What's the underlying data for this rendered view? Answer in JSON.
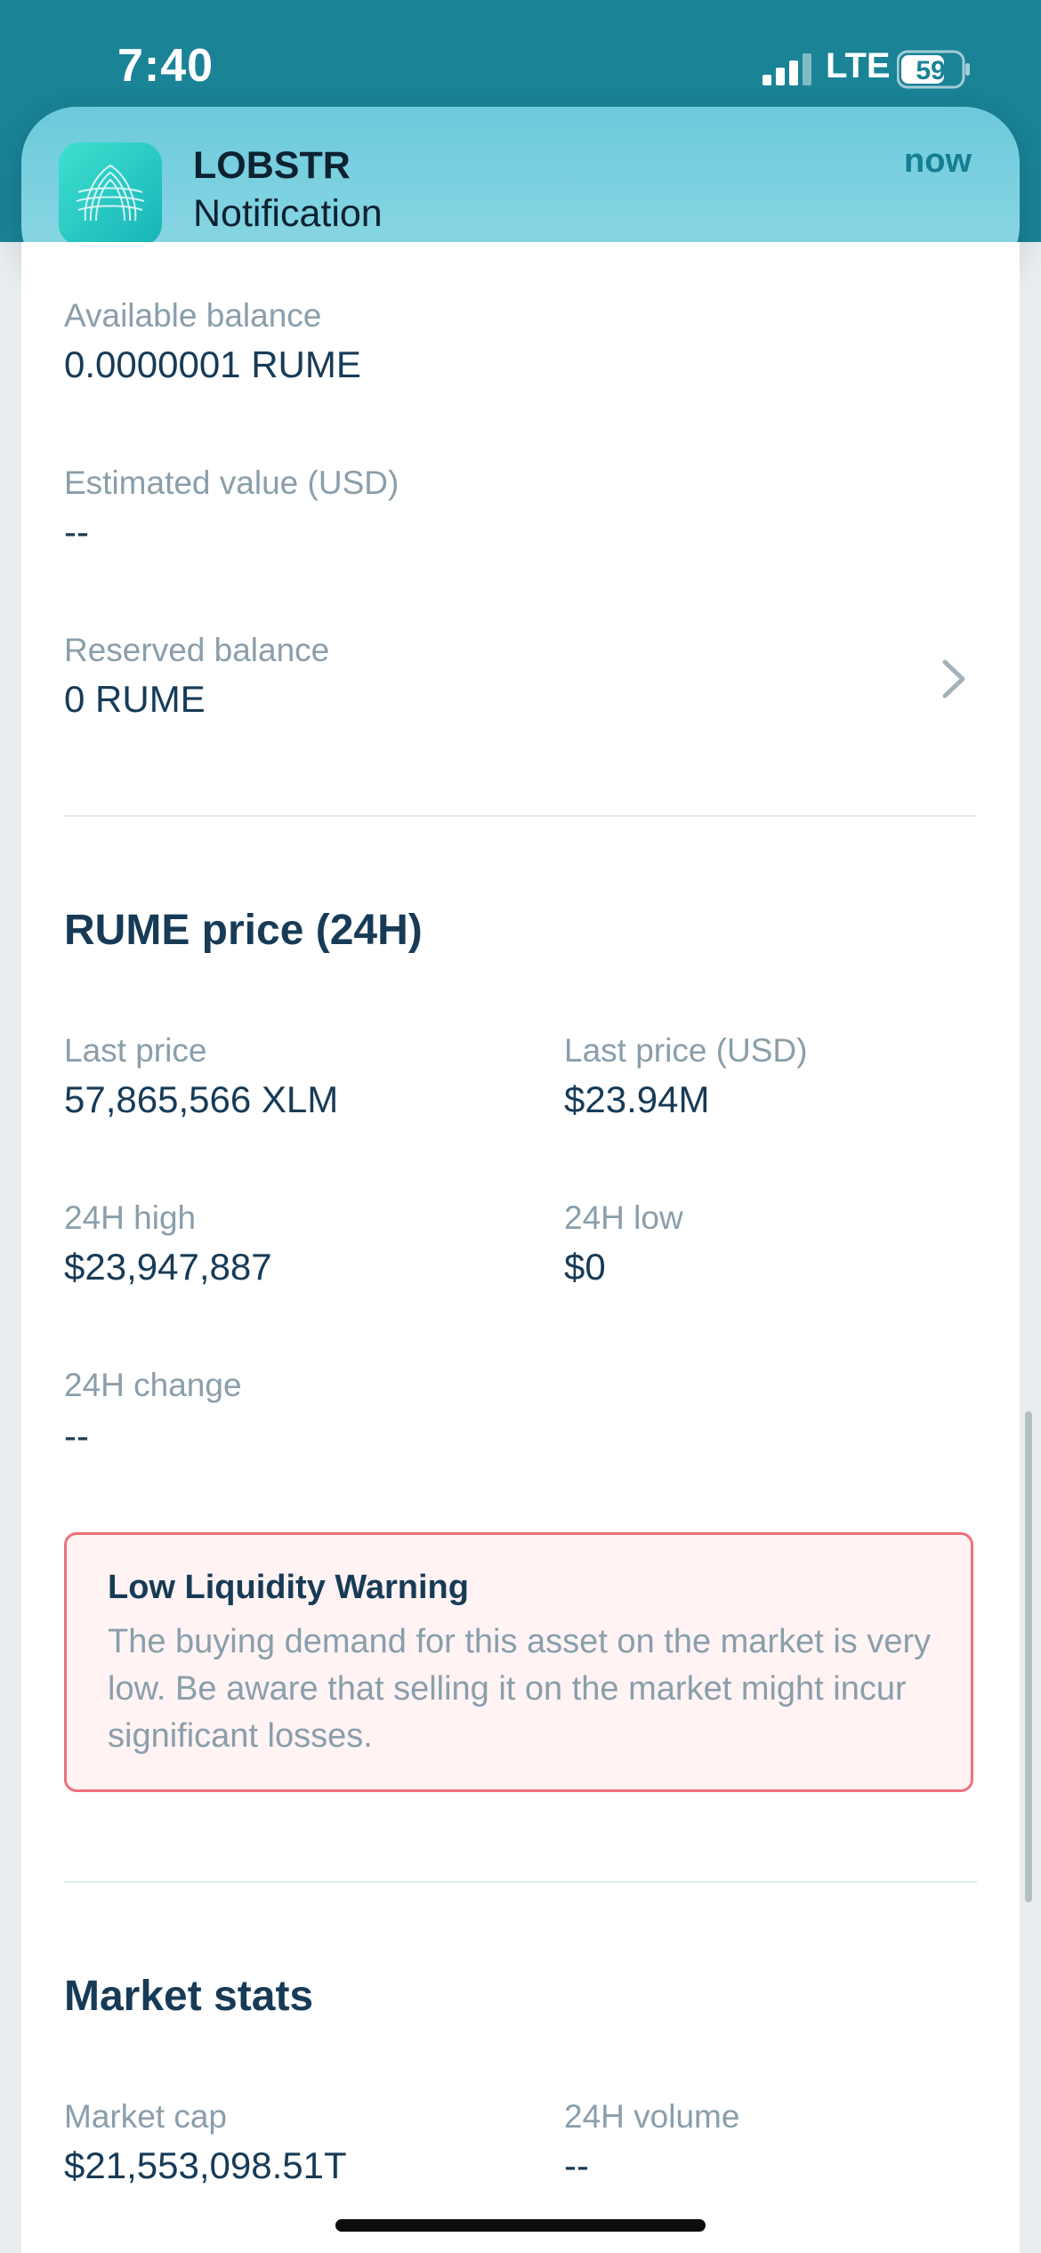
{
  "status_bar": {
    "time": "7:40",
    "network": "LTE",
    "battery": "59"
  },
  "notification": {
    "app": "LOBSTR",
    "body": "Notification",
    "time": "now"
  },
  "balances": {
    "available_label": "Available balance",
    "available_value": "0.0000001 RUME",
    "estimated_label": "Estimated value (USD)",
    "estimated_value": "--",
    "reserved_label": "Reserved balance",
    "reserved_value": "0 RUME"
  },
  "price": {
    "heading": "RUME price (24H)",
    "last_price_label": "Last price",
    "last_price_value": "57,865,566 XLM",
    "last_price_usd_label": "Last price (USD)",
    "last_price_usd_value": "$23.94M",
    "high_label": "24H high",
    "high_value": "$23,947,887",
    "low_label": "24H low",
    "low_value": "$0",
    "change_label": "24H change",
    "change_value": "--"
  },
  "warning": {
    "title": "Low Liquidity Warning",
    "text": "The buying demand for this asset on the market is very low. Be aware that selling it on the market might incur significant losses."
  },
  "market_stats": {
    "heading": "Market stats",
    "market_cap_label": "Market cap",
    "market_cap_value": "$21,553,098.51T",
    "volume_label": "24H volume",
    "volume_value": "--"
  },
  "colors": {
    "header_teal": "#1a8396",
    "text_dark": "#173b57",
    "text_muted": "#8a9eab",
    "warning_border": "#ef7079"
  }
}
